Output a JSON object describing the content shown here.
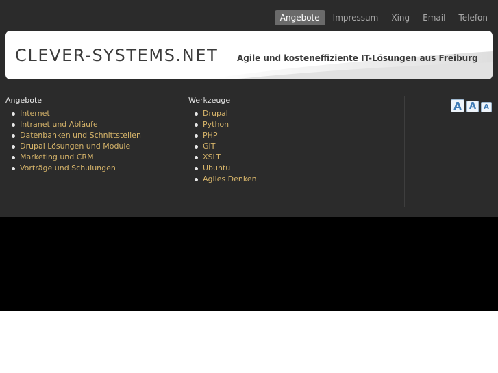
{
  "nav": {
    "items": [
      {
        "label": "Angebote",
        "active": true
      },
      {
        "label": "Impressum",
        "active": false
      },
      {
        "label": "Xing",
        "active": false
      },
      {
        "label": "Email",
        "active": false
      },
      {
        "label": "Telefon",
        "active": false
      }
    ]
  },
  "header": {
    "site_name": "CLEVER-SYSTEMS.NET",
    "tagline": "Agile und kosteneffiziente IT-Lösungen aus Freiburg"
  },
  "angebote": {
    "title": "Angebote",
    "items": [
      "Internet",
      "Intranet und Abläufe",
      "Datenbanken und Schnittstellen",
      "Drupal Lösungen und Module",
      "Marketing und CRM",
      "Vorträge und Schulungen"
    ]
  },
  "werkzeuge": {
    "title": "Werkzeuge",
    "items": [
      "Drupal",
      "Python",
      "PHP",
      "GIT",
      "XSLT",
      "Ubuntu",
      "Agiles Denken"
    ]
  },
  "font_size": {
    "large_label": "A",
    "medium_label": "A",
    "small_label": "A"
  },
  "colors": {
    "background": "#2b2b2b",
    "link": "#d6b46a",
    "active_nav": "#6a6a6a"
  }
}
